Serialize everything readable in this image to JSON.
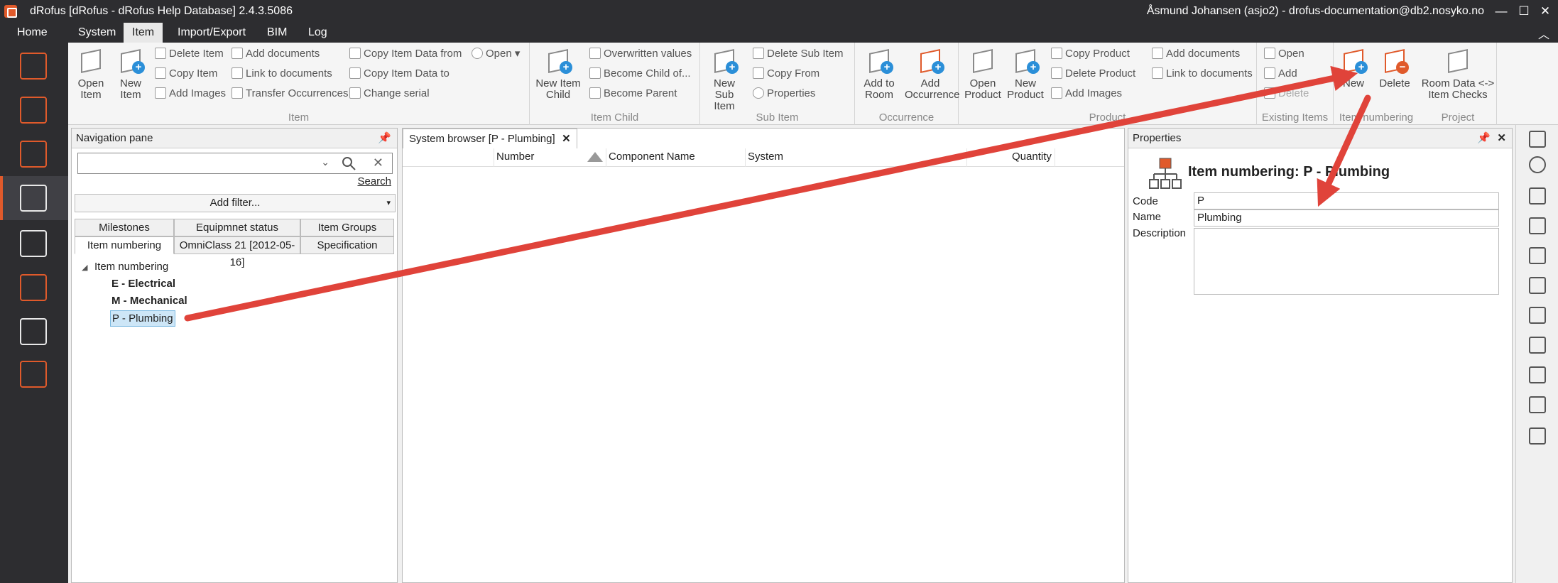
{
  "window": {
    "title": "dRofus [dRofus - dRofus Help Database] 2.4.3.5086",
    "user": "Åsmund Johansen (asjo2) - drofus-documentation@db2.nosyko.no",
    "minimize": "—",
    "maximize": "☐",
    "close": "✕",
    "collapse": "︿"
  },
  "menu": {
    "tabs": [
      "Home",
      "System",
      "Item",
      "Import/Export",
      "BIM",
      "Log"
    ],
    "active": "Item"
  },
  "ribbon": {
    "item": {
      "label": "Item",
      "open_item": "Open Item",
      "new_item": "New Item",
      "delete_item": "Delete Item",
      "copy_item": "Copy Item",
      "add_images": "Add Images",
      "add_documents": "Add documents",
      "link_documents": "Link to documents",
      "transfer_occurrences": "Transfer Occurrences",
      "copy_data_from": "Copy Item Data from",
      "copy_data_to": "Copy Item Data to",
      "change_serial": "Change serial",
      "open_dd": "Open"
    },
    "item_child": {
      "label": "Item Child",
      "new_item_child": "New Item Child",
      "overwritten_values": "Overwritten values",
      "become_child": "Become Child of...",
      "become_parent": "Become Parent"
    },
    "sub_item": {
      "label": "Sub Item",
      "new_sub_item": "New Sub Item",
      "delete_sub_item": "Delete Sub Item",
      "copy_from": "Copy From",
      "properties": "Properties"
    },
    "occurrence": {
      "label": "Occurrence",
      "add_to_room": "Add to Room",
      "add_occurrence": "Add Occurrence"
    },
    "product": {
      "label": "Product",
      "open_product": "Open Product",
      "new_product": "New Product",
      "copy_product": "Copy Product",
      "delete_product": "Delete Product",
      "add_images": "Add Images",
      "add_documents": "Add documents",
      "link_documents": "Link to documents"
    },
    "existing_items": {
      "label": "Existing Items",
      "open": "Open",
      "add": "Add",
      "delete": "Delete"
    },
    "item_numbering": {
      "label": "Item numbering",
      "new": "New",
      "delete": "Delete"
    },
    "project": {
      "label": "Project",
      "room_data_checks": "Room Data <-> Item Checks"
    }
  },
  "nav": {
    "title": "Navigation pane",
    "search_placeholder": "",
    "search_link": "Search",
    "add_filter": "Add filter...",
    "tabs_row1": [
      "Milestones",
      "Equipmnet status",
      "Item Groups"
    ],
    "tabs_row2": [
      "Item numbering",
      "OmniClass 21 [2012-05-16]",
      "Specification"
    ],
    "tree": {
      "root": "Item numbering",
      "children": [
        "E - Electrical",
        "M - Mechanical",
        "P - Plumbing"
      ]
    }
  },
  "system_browser": {
    "tab": "System browser [P - Plumbing]",
    "columns": [
      "Number",
      "Component Name",
      "System",
      "Quantity"
    ]
  },
  "properties": {
    "title": "Properties",
    "heading": "Item numbering: P - Plumbing",
    "code_label": "Code",
    "code_value": "P",
    "name_label": "Name",
    "name_value": "Plumbing",
    "description_label": "Description",
    "description_value": ""
  },
  "colors": {
    "accent": "#e05a2b",
    "arrow": "#e0433a",
    "chrome": "#2d2d30"
  }
}
